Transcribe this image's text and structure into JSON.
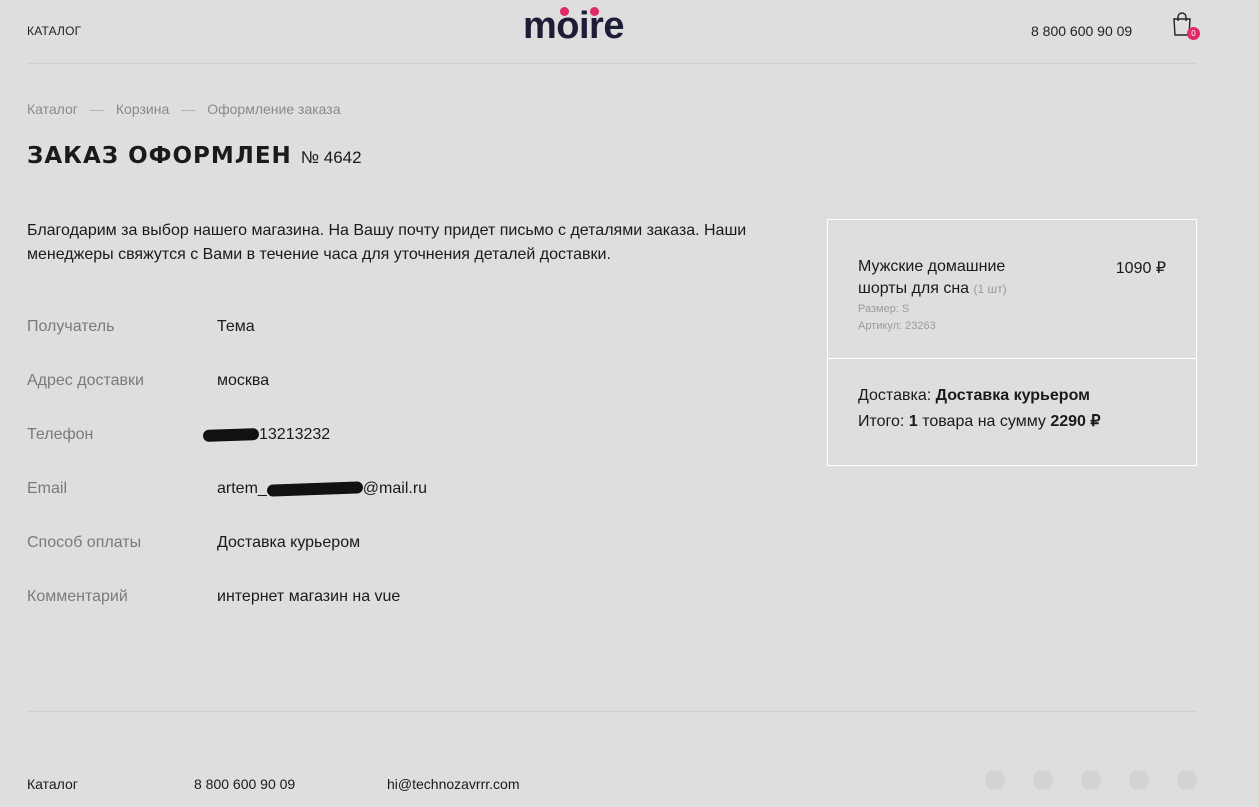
{
  "header": {
    "catalog_link": "КАТАЛОГ",
    "logo_text": "moire",
    "phone": "8 800 600 90 09",
    "cart_count": "0"
  },
  "breadcrumbs": [
    "Каталог",
    "Корзина",
    "Оформление заказа"
  ],
  "title": {
    "heading": "ЗАКАЗ ОФОРМЛЕН",
    "order_number": "№ 4642"
  },
  "intro": "Благодарим за выбор нашего магазина. На Вашу почту придет письмо с деталями заказа. Наши менеджеры свяжутся с Вами в течение часа для уточнения деталей доставки.",
  "details": [
    {
      "label": "Получатель",
      "value": "Тема"
    },
    {
      "label": "Адрес доставки",
      "value": "москва"
    },
    {
      "label": "Телефон",
      "value": "13213232"
    },
    {
      "label": "Email",
      "value_prefix": "artem_",
      "value_suffix": "@mail.ru"
    },
    {
      "label": "Способ оплаты",
      "value": "Доставка курьером"
    },
    {
      "label": "Комментарий",
      "value": "интернет магазин на vue"
    }
  ],
  "summary": {
    "item": {
      "name": "Мужские домашние шорты для сна",
      "qty": "(1 шт)",
      "price": "1090 ₽",
      "size": "Размер: S",
      "article": "Артикул: 23263"
    },
    "delivery_label": "Доставка:",
    "delivery_value": "Доставка курьером",
    "total_label": "Итого:",
    "total_count": "1",
    "total_mid": "товара на сумму",
    "total_sum": "2290 ₽"
  },
  "footer": {
    "catalog": "Каталог",
    "phone": "8 800 600 90 09",
    "email": "hi@technozavrrr.com",
    "socials": [
      "vk-icon",
      "instagram-icon",
      "facebook-icon",
      "twitter-icon",
      "telegram-icon"
    ]
  },
  "colors": {
    "accent": "#e02a68",
    "logo": "#1e1d36",
    "background": "#dedede"
  }
}
